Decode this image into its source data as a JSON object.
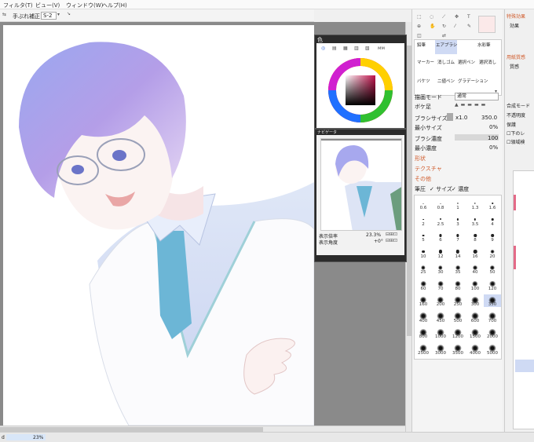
{
  "menu": [
    "フィルタ(T)",
    "ビュー(V)",
    "ウィンドウ(W)",
    "ヘルプ(H)"
  ],
  "toolbar": {
    "stabilizer_label": "手ぶれ補正",
    "stabilizer_value": "S-2"
  },
  "color_panel_title": "色",
  "navigator": {
    "title": "ナビゲータ",
    "zoom_label": "表示倍率",
    "zoom_value": "23.3%",
    "angle_label": "表示角度",
    "angle_value": "+0°"
  },
  "tools": {
    "row1": [
      "鉛筆",
      "エアブラシ",
      "水彩筆"
    ],
    "row2": [
      "マーカー",
      "消しゴム",
      "選択ペン",
      "選択消し"
    ],
    "row3": [
      "バケツ",
      "二値ペン",
      "グラデーション"
    ]
  },
  "brush_settings": {
    "draw_mode_label": "描画モード",
    "draw_mode_value": "通常",
    "edge_label": "ボケ足",
    "size_label": "ブラシサイズ",
    "size_multiplier": "x1.0",
    "size_value": "350.0",
    "min_size_label": "最小サイズ",
    "min_size_value": "0%",
    "density_label": "ブラシ濃度",
    "density_value": "100",
    "min_density_label": "最小濃度",
    "min_density_value": "0%",
    "shape_label": "形状",
    "texture_label": "テクスチャ",
    "other_label": "その他",
    "pressure_label": "筆圧",
    "pressure_size": "サイズ",
    "pressure_density": "濃度"
  },
  "brush_sizes": [
    "0.6",
    "0.8",
    "1",
    "1.3",
    "1.6",
    "2",
    "2.5",
    "3",
    "3.5",
    "4",
    "5",
    "6",
    "7",
    "8",
    "9",
    "10",
    "12",
    "14",
    "16",
    "20",
    "25",
    "30",
    "35",
    "40",
    "50",
    "60",
    "70",
    "80",
    "100",
    "120",
    "160",
    "200",
    "250",
    "300",
    "350",
    "400",
    "450",
    "500",
    "600",
    "700",
    "800",
    "1000",
    "1200",
    "1500",
    "2000",
    "2500",
    "3000",
    "3500",
    "4000",
    "5000"
  ],
  "selected_brush_size": "350",
  "right_panel": {
    "effects_title": "特殊効果",
    "effect_label": "効果",
    "paper_title": "用紙質感",
    "paper_label": "質感",
    "blend_label": "合成モード",
    "opacity_label": "不透明度",
    "protect_label": "保護",
    "protect_below": "下のレ",
    "protect_area": "領域検"
  },
  "status": {
    "left": "d",
    "progress": "23%"
  }
}
